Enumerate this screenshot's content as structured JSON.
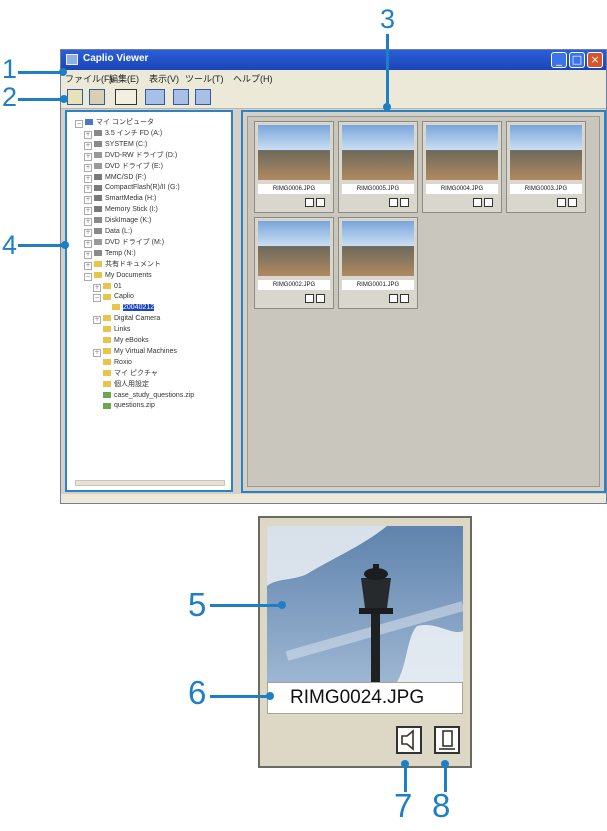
{
  "window": {
    "title": "Caplio Viewer",
    "controls": [
      "minimize-icon",
      "maximize-icon",
      "close-icon"
    ]
  },
  "menu": [
    "ファイル(F)",
    "編集(E)",
    "表示(V)",
    "ツール(T)",
    "ヘルプ(H)"
  ],
  "toolbar": [
    "new-folder-icon",
    "edit-icon",
    "sort-icon",
    "view-mode-icon",
    "slideshow-icon",
    "exit-icon"
  ],
  "tree": [
    {
      "label": "マイ コンピュータ",
      "depth": 0,
      "icon": "computer-icon",
      "expander": "−"
    },
    {
      "label": "3.5 インチ FD (A:)",
      "depth": 1,
      "icon": "floppy-icon",
      "expander": "+"
    },
    {
      "label": "SYSTEM (C:)",
      "depth": 1,
      "icon": "drive-icon",
      "expander": "+"
    },
    {
      "label": "DVD-RW ドライブ (D:)",
      "depth": 1,
      "icon": "dvd-icon",
      "expander": "+"
    },
    {
      "label": "DVD ドライブ (E:)",
      "depth": 1,
      "icon": "dvd-icon",
      "expander": "+"
    },
    {
      "label": "MMC/SD (F:)",
      "depth": 1,
      "icon": "card-icon",
      "expander": "+"
    },
    {
      "label": "CompactFlash(R)/II (G:)",
      "depth": 1,
      "icon": "card-icon",
      "expander": "+"
    },
    {
      "label": "SmartMedia (H:)",
      "depth": 1,
      "icon": "card-icon",
      "expander": "+"
    },
    {
      "label": "Memory Stick (I:)",
      "depth": 1,
      "icon": "card-icon",
      "expander": "+"
    },
    {
      "label": "DiskImage (K:)",
      "depth": 1,
      "icon": "drive-icon",
      "expander": "+"
    },
    {
      "label": "Data (L:)",
      "depth": 1,
      "icon": "drive-icon",
      "expander": "+"
    },
    {
      "label": "DVD ドライブ (M:)",
      "depth": 1,
      "icon": "dvd-icon",
      "expander": "+"
    },
    {
      "label": "Temp (N:)",
      "depth": 1,
      "icon": "drive-icon",
      "expander": "+"
    },
    {
      "label": "共有ドキュメント",
      "depth": 1,
      "icon": "folder-icon",
      "expander": "+"
    },
    {
      "label": "My Documents",
      "depth": 1,
      "icon": "folder-icon",
      "expander": "−"
    },
    {
      "label": "01",
      "depth": 2,
      "icon": "folder-icon",
      "expander": "+"
    },
    {
      "label": "Caplio",
      "depth": 2,
      "icon": "folder-icon",
      "expander": "−"
    },
    {
      "label": "20040212",
      "depth": 3,
      "icon": "folder-icon",
      "expander": "",
      "selected": true
    },
    {
      "label": "Digital Camera",
      "depth": 2,
      "icon": "folder-icon",
      "expander": "+"
    },
    {
      "label": "Links",
      "depth": 2,
      "icon": "folder-icon",
      "expander": ""
    },
    {
      "label": "My eBooks",
      "depth": 2,
      "icon": "folder-icon",
      "expander": ""
    },
    {
      "label": "My Virtual Machines",
      "depth": 2,
      "icon": "folder-icon",
      "expander": "+"
    },
    {
      "label": "Roxio",
      "depth": 2,
      "icon": "folder-icon",
      "expander": ""
    },
    {
      "label": "マイ ピクチャ",
      "depth": 2,
      "icon": "folder-icon",
      "expander": ""
    },
    {
      "label": "個人用設定",
      "depth": 2,
      "icon": "folder-icon",
      "expander": ""
    },
    {
      "label": "case_study_questions.zip",
      "depth": 2,
      "icon": "zip-icon",
      "expander": ""
    },
    {
      "label": "questions.zip",
      "depth": 2,
      "icon": "zip-icon",
      "expander": ""
    }
  ],
  "thumbnails": [
    {
      "filename": "RIMG0006.JPG",
      "icons": [
        "sound-icon",
        "memo-icon"
      ]
    },
    {
      "filename": "RIMG0005.JPG",
      "icons": [
        "sound-icon",
        "memo-icon"
      ]
    },
    {
      "filename": "RIMG0004.JPG",
      "icons": [
        "sound-icon",
        "memo-icon"
      ]
    },
    {
      "filename": "RIMG0003.JPG",
      "icons": [
        "sound-icon",
        "memo-icon"
      ]
    },
    {
      "filename": "RIMG0002.JPG",
      "icons": [
        "sound-icon",
        "memo-icon"
      ]
    },
    {
      "filename": "RIMG0001.JPG",
      "icons": [
        "sound-icon",
        "memo-icon"
      ]
    }
  ],
  "detail": {
    "filename": "RIMG0024.JPG",
    "icons": [
      "sound-icon",
      "memo-icon"
    ]
  },
  "callouts": [
    "1",
    "2",
    "3",
    "4",
    "5",
    "6",
    "7",
    "8"
  ],
  "colors": {
    "callout": "#1e7fc4",
    "title_bar": "#1b45b8",
    "pane_highlight": "#2b83c3"
  }
}
